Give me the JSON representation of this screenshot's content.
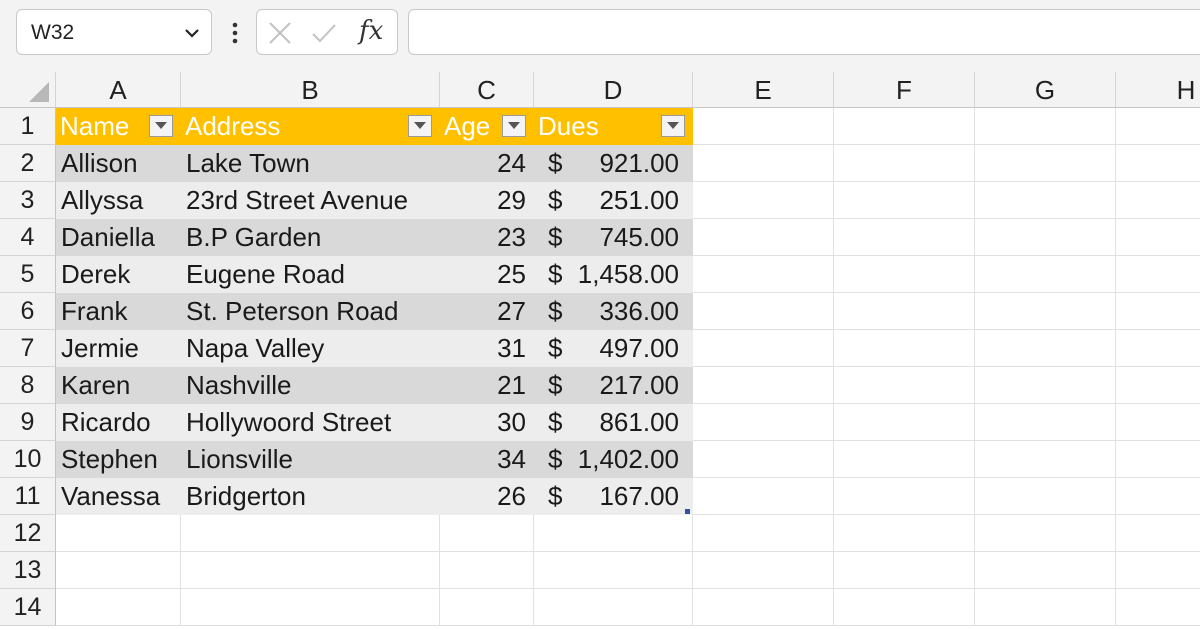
{
  "formula_bar": {
    "name_box": "W32",
    "fx_label": "fx",
    "formula_value": ""
  },
  "columns": [
    "A",
    "B",
    "C",
    "D",
    "E",
    "F",
    "G",
    "H"
  ],
  "row_numbers": [
    "1",
    "2",
    "3",
    "4",
    "5",
    "6",
    "7",
    "8",
    "9",
    "10",
    "11",
    "12",
    "13",
    "14"
  ],
  "table": {
    "headers": [
      "Name",
      "Address",
      "Age",
      "Dues"
    ],
    "rows": [
      {
        "name": "Allison",
        "address": "Lake Town",
        "age": "24",
        "currency": "$",
        "dues": "921.00"
      },
      {
        "name": "Allyssa",
        "address": "23rd Street Avenue",
        "age": "29",
        "currency": "$",
        "dues": "251.00"
      },
      {
        "name": "Daniella",
        "address": "B.P Garden",
        "age": "23",
        "currency": "$",
        "dues": "745.00"
      },
      {
        "name": "Derek",
        "address": "Eugene Road",
        "age": "25",
        "currency": "$",
        "dues": "1,458.00"
      },
      {
        "name": "Frank",
        "address": "St. Peterson Road",
        "age": "27",
        "currency": "$",
        "dues": "336.00"
      },
      {
        "name": "Jermie",
        "address": "Napa Valley",
        "age": "31",
        "currency": "$",
        "dues": "497.00"
      },
      {
        "name": "Karen",
        "address": "Nashville",
        "age": "21",
        "currency": "$",
        "dues": "217.00"
      },
      {
        "name": "Ricardo",
        "address": "Hollywoord Street",
        "age": "30",
        "currency": "$",
        "dues": "861.00"
      },
      {
        "name": "Stephen",
        "address": "Lionsville",
        "age": "34",
        "currency": "$",
        "dues": "1,402.00"
      },
      {
        "name": "Vanessa",
        "address": "Bridgerton",
        "age": "26",
        "currency": "$",
        "dues": "167.00"
      }
    ]
  },
  "colors": {
    "header_fill": "#ffc000",
    "band_dark": "#d9d9d9",
    "band_light": "#ededed"
  }
}
